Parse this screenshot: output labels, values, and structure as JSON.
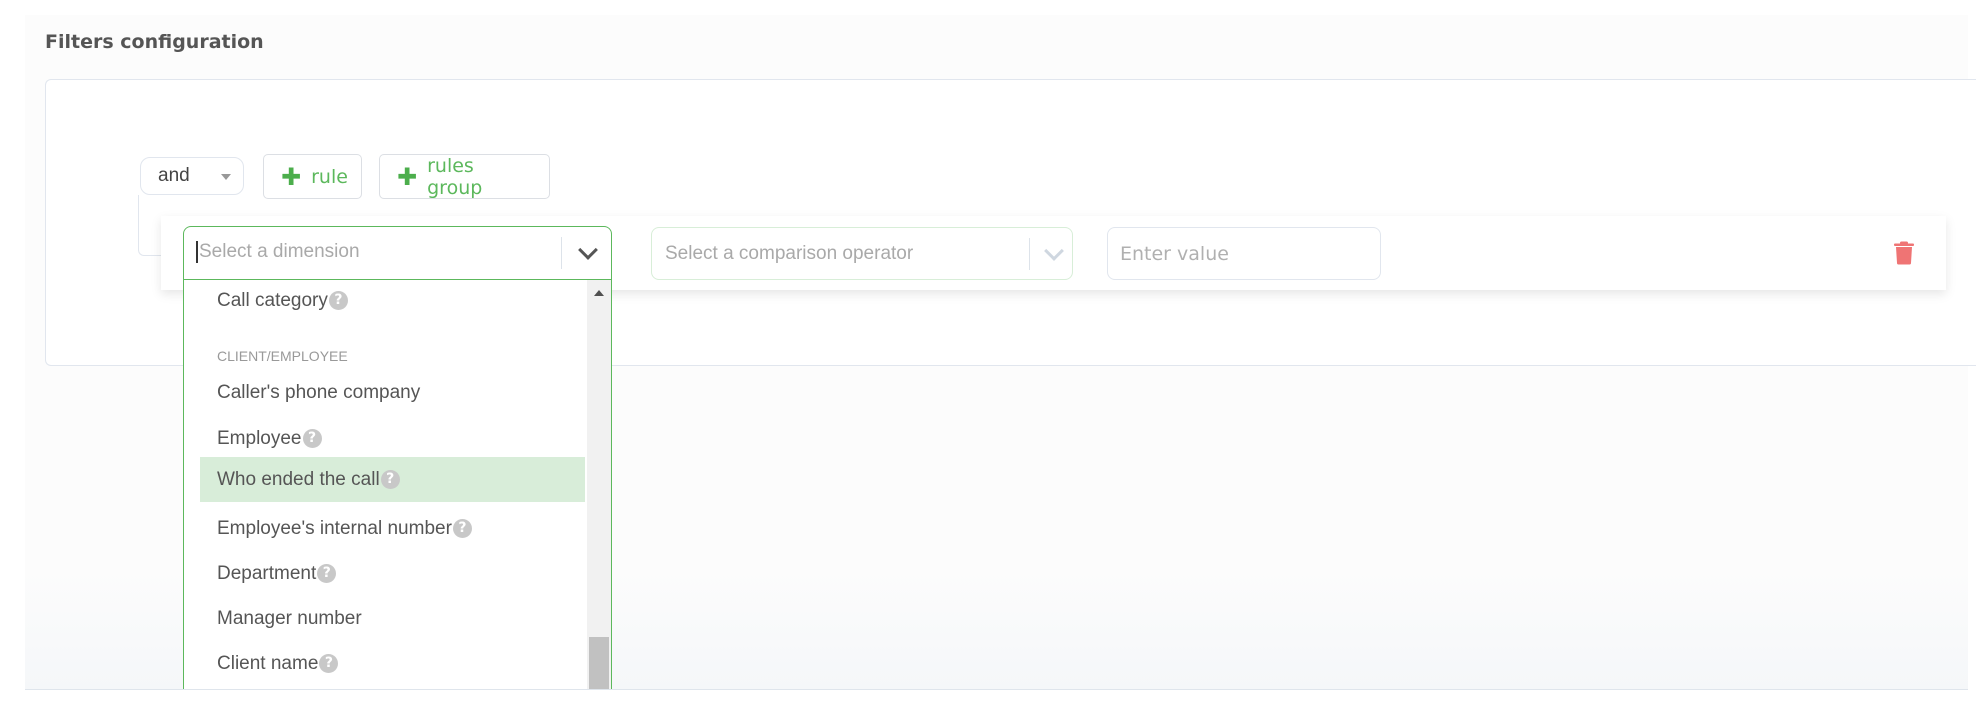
{
  "page": {
    "title": "Filters configuration"
  },
  "toolbar": {
    "logic_operator": "and",
    "add_rule_label": "rule",
    "add_rules_group_label": "rules group"
  },
  "rule": {
    "dimension_placeholder": "Select a dimension",
    "operator_placeholder": "Select a comparison operator",
    "value_placeholder": "Enter value",
    "delete_icon": "trash-icon"
  },
  "dropdown": {
    "items": [
      {
        "type": "option",
        "label": "Call category",
        "help": true
      },
      {
        "type": "group",
        "label": "CLIENT/EMPLOYEE"
      },
      {
        "type": "option",
        "label": "Caller's phone company",
        "help": false
      },
      {
        "type": "option",
        "label": "Employee",
        "help": true
      },
      {
        "type": "option",
        "label": "Who ended the call",
        "help": true,
        "highlighted": true
      },
      {
        "type": "option",
        "label": "Employee's internal number",
        "help": true
      },
      {
        "type": "option",
        "label": "Department",
        "help": true
      },
      {
        "type": "option",
        "label": "Manager number",
        "help": false
      },
      {
        "type": "option",
        "label": "Client name",
        "help": true
      }
    ],
    "help_glyph": "?"
  },
  "colors": {
    "accent_green": "#5cb85c",
    "highlight": "#d8edd9",
    "delete_red": "#ef7474"
  }
}
